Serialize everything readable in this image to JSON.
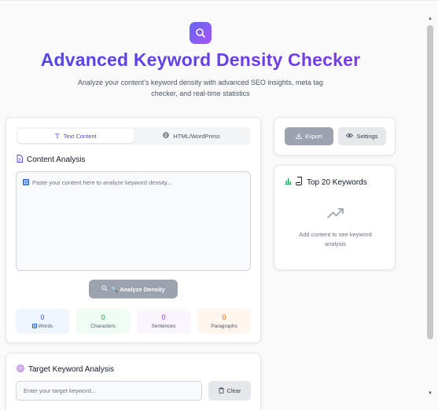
{
  "header": {
    "logo_icon": "search-icon",
    "title": "Advanced Keyword Density Checker",
    "subtitle": "Analyze your content's keyword density with advanced SEO insights, meta tag checker, and real-time statistics"
  },
  "tabs": [
    {
      "label": "Text Content",
      "icon": "text-icon",
      "active": true
    },
    {
      "label": "HTML/WordPress",
      "icon": "globe-icon",
      "active": false
    }
  ],
  "content_analysis": {
    "heading": "Content Analysis",
    "placeholder": "Paste your content here to analyze keyword density...",
    "analyze_button": "🔍 Analyze Density"
  },
  "stats": [
    {
      "value": "0",
      "label": "Words",
      "color": "#2563eb"
    },
    {
      "value": "0",
      "label": "Characters",
      "color": "#16a34a"
    },
    {
      "value": "0",
      "label": "Sentences",
      "color": "#9333ea"
    },
    {
      "value": "0",
      "label": "Paragraphs",
      "color": "#ea580c"
    }
  ],
  "target_keyword": {
    "heading": "Target Keyword Analysis",
    "placeholder": "Enter your target keyword...",
    "clear_button": "Clear"
  },
  "actions": {
    "export_label": "Export",
    "settings_label": "Settings"
  },
  "top_keywords": {
    "heading": "Top 20 Keywords",
    "empty_text": "Add content to see keyword analysis"
  },
  "colors": {
    "accent": "#4f46e5",
    "accent_secondary": "#a855f7"
  }
}
